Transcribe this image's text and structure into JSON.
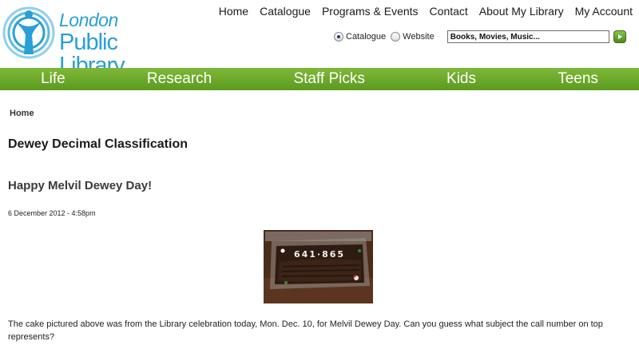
{
  "logo": {
    "line1": "London",
    "line2": "Public Library"
  },
  "topnav": [
    "Home",
    "Catalogue",
    "Programs & Events",
    "Contact",
    "About My Library",
    "My Account"
  ],
  "search": {
    "radio_options": [
      {
        "label": "Catalogue",
        "selected": true
      },
      {
        "label": "Website",
        "selected": false
      }
    ],
    "value": "Books, Movies, Music..."
  },
  "mainnav": [
    "Life",
    "Research",
    "Staff Picks",
    "Kids",
    "Teens"
  ],
  "breadcrumb": "Home",
  "page_title": "Dewey Decimal Classification",
  "post": {
    "title": "Happy Melvil Dewey Day!",
    "date": "6 December 2012 - 4:58pm",
    "cake_text": "641·865",
    "body": "The cake pictured above was from the Library celebration today, Mon. Dec. 10, for Melvil Dewey Day. Can you guess what subject the call number on top represents?"
  },
  "colors": {
    "brand_blue": "#2a9fd6",
    "nav_green": "#6aa82a",
    "go_button": "#6aaa28"
  }
}
